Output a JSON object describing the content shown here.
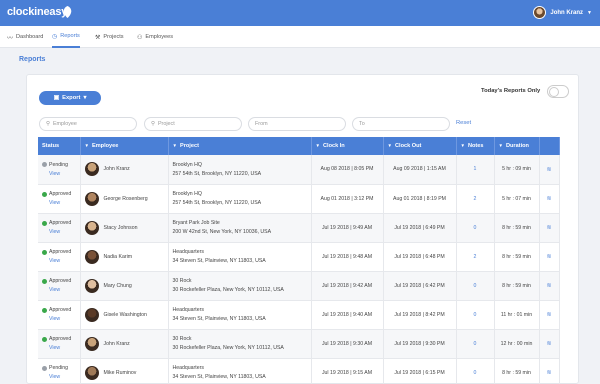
{
  "app": {
    "logo_text": "clockineasy",
    "user_name": "John Kranz"
  },
  "nav": [
    {
      "label": "Dashboard",
      "icon": "chart-line-icon"
    },
    {
      "label": "Reports",
      "icon": "clock-icon"
    },
    {
      "label": "Projects",
      "icon": "projects-icon"
    },
    {
      "label": "Employees",
      "icon": "users-icon"
    }
  ],
  "page": {
    "title": "Reports"
  },
  "toolbar": {
    "export_label": "Export",
    "today_label": "Today's Reports Only"
  },
  "filters": {
    "employee_placeholder": "Employee",
    "project_placeholder": "Project",
    "from_placeholder": "From",
    "to_placeholder": "To",
    "reset_label": "Reset"
  },
  "table": {
    "headers": [
      "Status",
      "Employee",
      "Project",
      "Clock In",
      "Clock Out",
      "Notes",
      "Duration"
    ],
    "rows": [
      {
        "status": "Pending",
        "status_type": "pending",
        "view": "View",
        "employee": "John Kranz",
        "project": "Brooklyn HQ",
        "address": "257 54th St, Brooklyn, NY 11220, USA",
        "clock_in": "Aug 08 2018 | 8:05 PM",
        "clock_out": "Aug 09 2018 | 1:15 AM",
        "notes": "1",
        "duration": "5 hr : 09 min"
      },
      {
        "status": "Approved",
        "status_type": "approved",
        "view": "View",
        "employee": "George Rosenberg",
        "project": "Brooklyn HQ",
        "address": "257 54th St, Brooklyn, NY 11220, USA",
        "clock_in": "Aug 01 2018 | 3:12 PM",
        "clock_out": "Aug 01 2018 | 8:19 PM",
        "notes": "2",
        "duration": "5 hr : 07 min"
      },
      {
        "status": "Approved",
        "status_type": "approved",
        "view": "View",
        "employee": "Stacy Johnson",
        "project": "Bryant Park Job Site",
        "address": "200 W 42nd St, New York, NY 10036, USA",
        "clock_in": "Jul 19 2018 | 9:49 AM",
        "clock_out": "Jul 19 2018 | 6:49 PM",
        "notes": "0",
        "duration": "8 hr : 59 min"
      },
      {
        "status": "Approved",
        "status_type": "approved",
        "view": "View",
        "employee": "Nadia Karim",
        "project": "Headquarters",
        "address": "34 Steven St, Plainview, NY 11803, USA",
        "clock_in": "Jul 19 2018 | 9:48 AM",
        "clock_out": "Jul 19 2018 | 6:48 PM",
        "notes": "2",
        "duration": "8 hr : 59 min"
      },
      {
        "status": "Approved",
        "status_type": "approved",
        "view": "View",
        "employee": "Mary Chung",
        "project": "30 Rock",
        "address": "30 Rockefeller Plaza, New York, NY 10112, USA",
        "clock_in": "Jul 19 2018 | 9:42 AM",
        "clock_out": "Jul 19 2018 | 6:42 PM",
        "notes": "0",
        "duration": "8 hr : 59 min"
      },
      {
        "status": "Approved",
        "status_type": "approved",
        "view": "View",
        "employee": "Gisele Washington",
        "project": "Headquarters",
        "address": "34 Steven St, Plainview, NY 11803, USA",
        "clock_in": "Jul 19 2018 | 9:40 AM",
        "clock_out": "Jul 19 2018 | 8:42 PM",
        "notes": "0",
        "duration": "11 hr : 01 min"
      },
      {
        "status": "Approved",
        "status_type": "approved",
        "view": "View",
        "employee": "John Kranz",
        "project": "30 Rock",
        "address": "30 Rockefeller Plaza, New York, NY 10112, USA",
        "clock_in": "Jul 19 2018 | 9:30 AM",
        "clock_out": "Jul 19 2018 | 9:30 PM",
        "notes": "0",
        "duration": "12 hr : 00 min"
      },
      {
        "status": "Pending",
        "status_type": "pending",
        "view": "View",
        "employee": "Mike Ruminov",
        "project": "Headquarters",
        "address": "34 Steven St, Plainview, NY 11803, USA",
        "clock_in": "Jul 19 2018 | 9:15 AM",
        "clock_out": "Jul 19 2018 | 6:15 PM",
        "notes": "0",
        "duration": "8 hr : 59 min"
      }
    ]
  },
  "colors": {
    "accent": "#4a7fd6",
    "approved": "#3aa84a",
    "pending": "#9aa0a8"
  }
}
